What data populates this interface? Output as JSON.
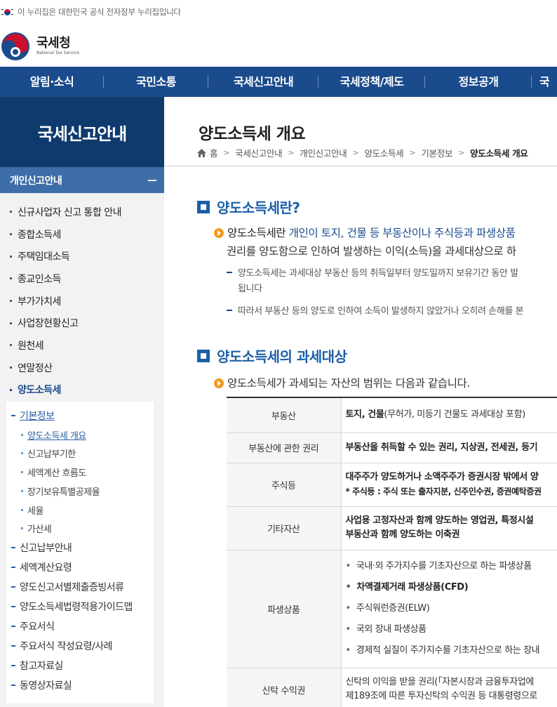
{
  "gov_banner": {
    "text": "이 누리집은 대한민국 공식 전자정부 누리집입니다"
  },
  "logo": {
    "ko": "국세청",
    "en": "National Tax Service"
  },
  "gnb": [
    "알림·소식",
    "국민소통",
    "국세신고안내",
    "국세정책/제도",
    "정보공개",
    "국"
  ],
  "lnb": {
    "title": "국세신고안내",
    "section": "개인신고안내",
    "items": [
      "신규사업자 신고 통합 안내",
      "종합소득세",
      "주택임대소득",
      "종교인소득",
      "부가가치세",
      "사업장현황신고",
      "원천세",
      "연말정산",
      "양도소득세"
    ],
    "sub": [
      {
        "label": "기본정보",
        "level": 1,
        "on": true
      },
      {
        "label": "양도소득세 개요",
        "level": 2,
        "on": true
      },
      {
        "label": "신고납부기한",
        "level": 2
      },
      {
        "label": "세액계산 흐름도",
        "level": 2
      },
      {
        "label": "장기보유특별공제율",
        "level": 2
      },
      {
        "label": "세율",
        "level": 2
      },
      {
        "label": "가산세",
        "level": 2
      },
      {
        "label": "신고납부안내",
        "level": 1
      },
      {
        "label": "세액계산요령",
        "level": 1
      },
      {
        "label": "양도신고서별제출증빙서류",
        "level": 1
      },
      {
        "label": "양도소득세법령적용가이드맵",
        "level": 1
      },
      {
        "label": "주요서식",
        "level": 1
      },
      {
        "label": "주요서식 작성요령/사례",
        "level": 1
      },
      {
        "label": "참고자료실",
        "level": 1
      },
      {
        "label": "동영상자료실",
        "level": 1
      }
    ]
  },
  "page": {
    "title": "양도소득세 개요",
    "breadcrumb": [
      "홈",
      "국세신고안내",
      "개인신고안내",
      "양도소득세",
      "기본정보",
      "양도소득세 개요"
    ]
  },
  "section1": {
    "heading": "양도소득세란?",
    "lead_a": "양도소득세란",
    "lead_b": " 개인이 토지, 건물 등 부동산이나 주식등과 파생상품",
    "lead_line2": "권리를 양도함으로 인하여 발생하는 이익(소득)을 과세대상으로 하",
    "note1a": "양도소득세는 과세대상 부동산 등의 취득일부터 양도일까지 보유기간 동안 발",
    "note1b": "됩니다",
    "note2": "따라서 부동산 등의 양도로 인하여 소득이 발생하지 않았거나 오히려 손해를 본"
  },
  "section2": {
    "heading": "양도소득세의 과세대상",
    "lead": "양도소득세가 과세되는 자산의 범위는 다음과 같습니다.",
    "table": [
      {
        "head": "부동산",
        "bold": "토지, 건물",
        "text": "(무허가, 미등기 건물도 과세대상 포함)"
      },
      {
        "head": "부동산에 관한 권리",
        "bold": "부동산을 취득할 수 있는 권리, 지상권, 전세권, 등기"
      },
      {
        "head": "주식등",
        "bold": "대주주가 양도하거나 소액주주가 증권시장 밖에서 양",
        "line2": "* 주식등 : 주식 또는 출자지분, 신주인수권, 증권예탁증권"
      },
      {
        "head": "기타자산",
        "bold": "사업용 고정자산과 함께 양도하는 영업권, 특정시설",
        "bold2": "부동산과 함께 양도하는 이축권"
      },
      {
        "head": "파생상품",
        "list": [
          "국내·외 주가지수를 기초자산으로 하는 파생상품",
          "차액결제거래 파생상품(CFD)",
          "주식워런증권(ELW)",
          "국외 장내 파생상품",
          "경제적 실질이 주가지수를 기초자산으로 하는 장내"
        ]
      },
      {
        "head": "신탁 수익권",
        "text": "신탁의 이익을 받을 권리(「자본시장과 금융투자업에",
        "line2": "제189조에 따른 투자신탁의 수익권 등 대통령령으로"
      }
    ]
  }
}
